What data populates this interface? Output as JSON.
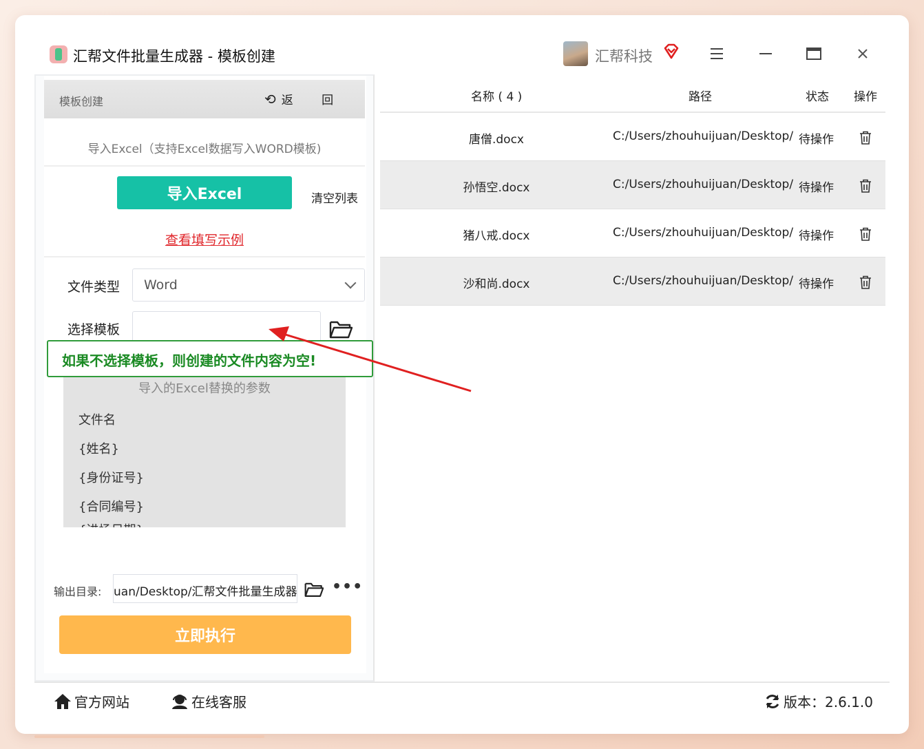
{
  "window": {
    "title": "汇帮文件批量生成器 - 模板创建",
    "brand": "汇帮科技"
  },
  "left": {
    "header_title": "模板创建",
    "back_label": "返 回",
    "import_desc": "导入Excel（支持Excel数据写入WORD模板)",
    "import_button": "导入Excel",
    "clear_button": "清空列表",
    "example_link": "查看填写示例",
    "file_type_label": "文件类型",
    "file_type_value": "Word",
    "template_label": "选择模板",
    "template_value": "",
    "callout": "如果不选择模板，则创建的文件内容为空!",
    "params_title": "导入的Excel替换的参数",
    "params": [
      "文件名",
      "{姓名}",
      "{身份证号}",
      "{合同编号}",
      "{进场日期}"
    ],
    "output_label": "输出目录:",
    "output_value": "uan/Desktop/汇帮文件批量生成器",
    "more_button": "•••",
    "run_button": "立即执行"
  },
  "table": {
    "headers": {
      "name": "名称 ( 4 )",
      "path": "路径",
      "state": "状态",
      "action": "操作"
    },
    "rows": [
      {
        "name": "唐僧.docx",
        "path": "C:/Users/zhouhuijuan/Desktop/",
        "state": "待操作"
      },
      {
        "name": "孙悟空.docx",
        "path": "C:/Users/zhouhuijuan/Desktop/",
        "state": "待操作"
      },
      {
        "name": "猪八戒.docx",
        "path": "C:/Users/zhouhuijuan/Desktop/",
        "state": "待操作"
      },
      {
        "name": "沙和尚.docx",
        "path": "C:/Users/zhouhuijuan/Desktop/",
        "state": "待操作"
      }
    ]
  },
  "footer": {
    "website": "官方网站",
    "service": "在线客服",
    "version": "版本：2.6.1.0"
  },
  "colors": {
    "import_button": "#16c1a6",
    "run_button": "#ffb84d",
    "example_link": "#e0262b",
    "callout": "#1a8a23",
    "arrow": "#e02020"
  }
}
